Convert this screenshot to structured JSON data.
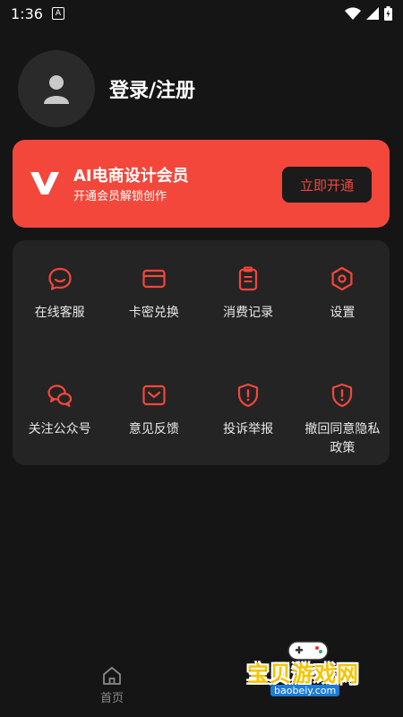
{
  "status_bar": {
    "time": "1:36",
    "notification_icon": "A"
  },
  "profile": {
    "login_label": "登录/注册"
  },
  "vip": {
    "title": "AI电商设计会员",
    "subtitle": "开通会员解锁创作",
    "button": "立即开通",
    "accent_color": "#f4473b"
  },
  "menu": {
    "items": [
      {
        "label": "在线客服",
        "icon": "chat-bubble-icon"
      },
      {
        "label": "卡密兑换",
        "icon": "card-icon"
      },
      {
        "label": "消费记录",
        "icon": "clipboard-icon"
      },
      {
        "label": "设置",
        "icon": "hexagon-gear-icon"
      },
      {
        "label": "关注公众号",
        "icon": "wechat-icon"
      },
      {
        "label": "意见反馈",
        "icon": "mail-feedback-icon"
      },
      {
        "label": "投诉举报",
        "icon": "shield-alert-icon"
      },
      {
        "label": "撤回同意隐私政策",
        "label_line1": "撤回同意隐私",
        "label_line2": "政策",
        "icon": "shield-alert-icon"
      }
    ]
  },
  "bottom_nav": {
    "home_label": "首页"
  },
  "watermark": {
    "title": "宝贝游戏网",
    "url": "baobeiy.com"
  }
}
